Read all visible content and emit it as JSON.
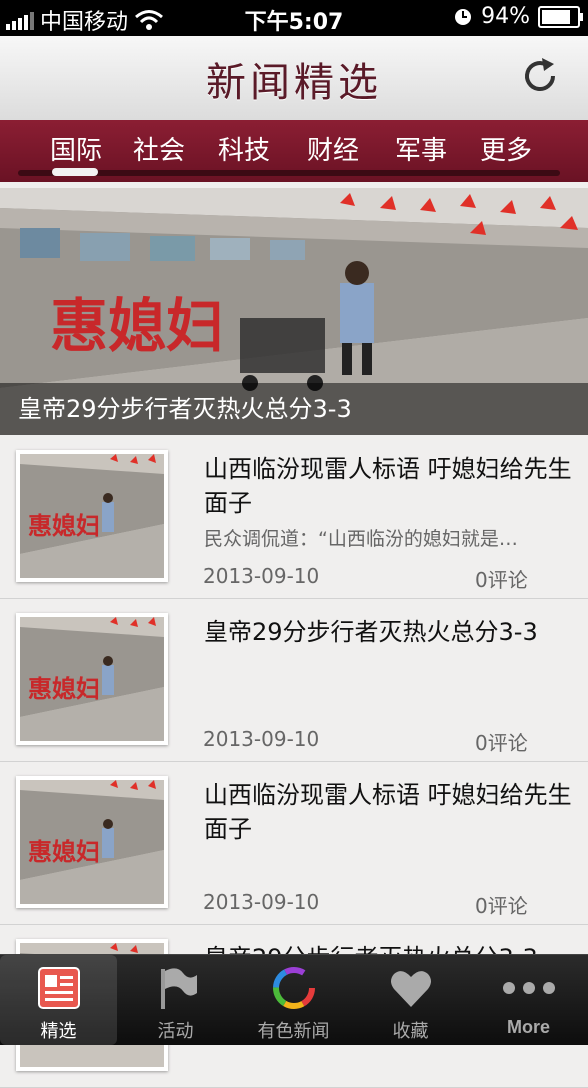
{
  "status": {
    "carrier": "中国移动",
    "time": "下午5:07",
    "battery": "94%",
    "battery_level": 0.94
  },
  "header": {
    "title": "新闻精选"
  },
  "tabs": [
    "国际",
    "社会",
    "科技",
    "财经",
    "军事",
    "更多"
  ],
  "hero": {
    "caption": "皇帝29分步行者灭热火总分3-3",
    "banner_text": "惠媳妇"
  },
  "news": [
    {
      "headline": "山西临汾现雷人标语 吁媳妇给先生面子",
      "summary": "民众调侃道：“山西临汾的媳妇就是…",
      "date": "2013-09-10",
      "comments": "0评论"
    },
    {
      "headline": "皇帝29分步行者灭热火总分3-3",
      "summary": "",
      "date": "2013-09-10",
      "comments": "0评论"
    },
    {
      "headline": "山西临汾现雷人标语 吁媳妇给先生面子",
      "summary": "",
      "date": "2013-09-10",
      "comments": "0评论"
    },
    {
      "headline": "皇帝29分步行者灭热火总分3-3",
      "summary": "",
      "date": "",
      "comments": ""
    }
  ],
  "tabbar": [
    {
      "label": "精选",
      "icon": "news-paper-icon"
    },
    {
      "label": "活动",
      "icon": "flag-icon"
    },
    {
      "label": "有色新闻",
      "icon": "color-ring-icon"
    },
    {
      "label": "收藏",
      "icon": "heart-icon"
    },
    {
      "label": "More",
      "icon": "more-dots-icon"
    }
  ]
}
